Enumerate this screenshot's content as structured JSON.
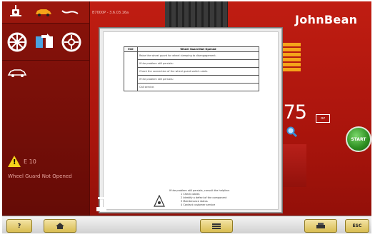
{
  "app": {
    "brand": "JohnBean",
    "header_text": "B7000P - 3.6.03.16a"
  },
  "sidebar": {
    "icons": [
      "wheel-balancer-icon",
      "car-icon",
      "wrench-icon",
      "wheel-icon",
      "swap-icon",
      "rim-icon",
      "car-profile-icon"
    ],
    "error_code": "E 10",
    "error_message": "Wheel Guard Not Opened"
  },
  "measurement": {
    "value": ".75",
    "unit": "oz"
  },
  "start_button": {
    "label": "START"
  },
  "help_doc": {
    "table_header_left": "E10",
    "table_header_title": "Wheel Guard Not Opened",
    "steps": [
      "Raise the wheel guard for wheel clamping to disengagement.",
      "If the problem still persists:",
      "Check the connection of the wheel guard switch cable.",
      "If the problem still persists:",
      "Call service."
    ],
    "footer_intro": "If the problem still persists, consult the helpline:",
    "footer_items": [
      "1  Check cables",
      "2  Identify a defect of the component",
      "3  Maintenance status",
      "4  Contact customer service"
    ]
  },
  "bottom_bar": {
    "help_label": "?",
    "esc_label": "ESC"
  },
  "colors": {
    "background_red": "#b31810",
    "accent_yellow": "#f5a51a",
    "start_green": "#2d8e21"
  }
}
